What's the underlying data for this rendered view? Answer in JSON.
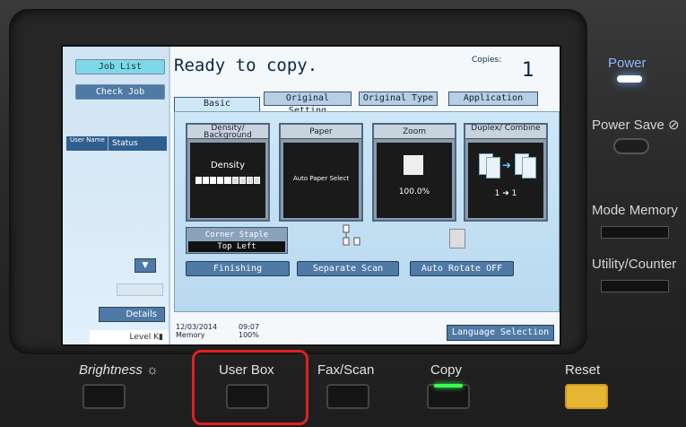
{
  "screen": {
    "left_panel": {
      "job_list": "Job List",
      "check_job": "Check Job",
      "list_columns": [
        "User Name",
        "Status"
      ],
      "details": "Details",
      "level_text": "Level"
    },
    "status": {
      "ready": "Ready to copy.",
      "copies_label": "Copies:",
      "copies_value": "1"
    },
    "tabs": [
      "Basic",
      "Original Setting",
      "Original Type",
      "Application"
    ],
    "functions": {
      "density_title": "Density/ Background",
      "density_label": "Density",
      "paper_title": "Paper",
      "paper_value": "Auto Paper Select",
      "zoom_title": "Zoom",
      "zoom_value": "100.0%",
      "duplex_title": "Duplex/ Combine",
      "duplex_value": "1 ➜ 1"
    },
    "finishing": {
      "staple_line1": "Corner Staple",
      "staple_line2": "Top Left",
      "finishing_btn": "Finishing",
      "separate_scan": "Separate Scan",
      "auto_rotate": "Auto Rotate OFF"
    },
    "bottom": {
      "date": "12/03/2014",
      "memory_label": "Memory",
      "time": "09:07",
      "memory_value": "100%",
      "language": "Language Selection"
    }
  },
  "hardware": {
    "power": "Power",
    "power_save": "Power Save",
    "mode_memory": "Mode Memory",
    "utility_counter": "Utility/Counter",
    "brightness": "Brightness",
    "user_box": "User Box",
    "fax_scan": "Fax/Scan",
    "copy": "Copy",
    "reset": "Reset"
  },
  "colors": {
    "highlight": "#e02020",
    "power_led": "#6fa8ff",
    "copy_led": "#39ff52"
  },
  "density_level": 0.6
}
